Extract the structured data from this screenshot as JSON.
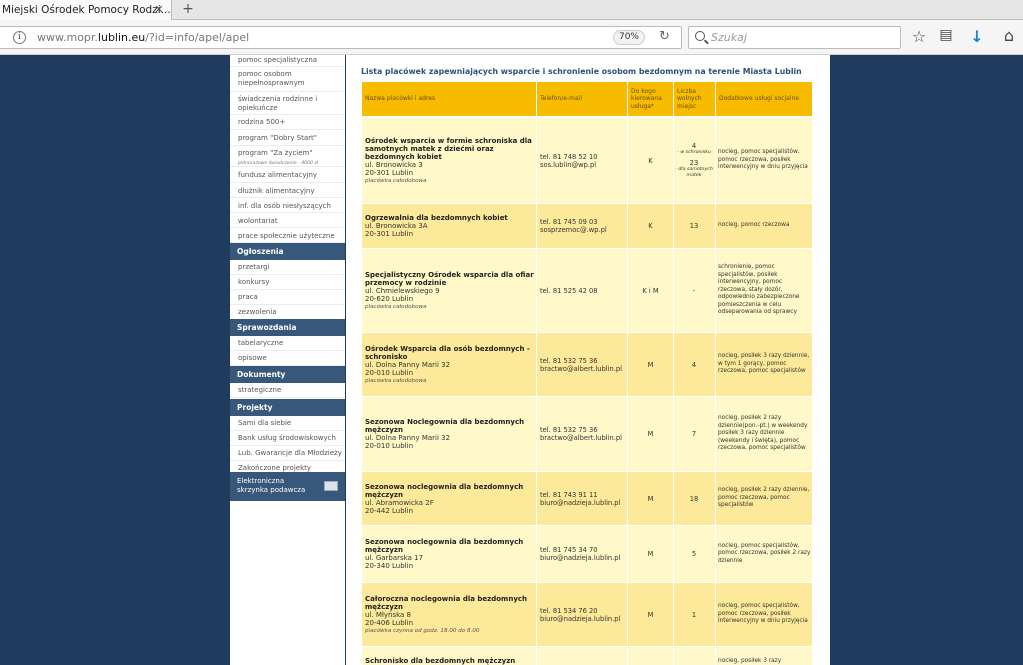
{
  "browser": {
    "tab_title": "Miejski Ośrodek Pomocy Rodzi...",
    "url_prefix": "www.mopr.",
    "url_domain": "lublin.eu",
    "url_suffix": "/?id=info/apel/apel",
    "zoom": "70%",
    "search_placeholder": "Szukaj"
  },
  "sidebar": {
    "items_top": [
      {
        "label": "pomoc specjalistyczna"
      },
      {
        "label": "pomoc osobom",
        "label2": "niepełnosprawnym"
      },
      {
        "label": "świadczenia rodzinne i",
        "label2": "opiekuńcze"
      },
      {
        "label": "rodzina 500+"
      },
      {
        "label": "program \"Dobry Start\""
      },
      {
        "label": "program \"Za życiem\"",
        "sub": "jednorazowe świadczenie - 4000 zł"
      },
      {
        "label": "fundusz alimentacyjny"
      },
      {
        "label": "dłużnik alimentacyjny"
      },
      {
        "label": "inf. dla osób niesłyszących"
      },
      {
        "label": "wolontariat"
      },
      {
        "label": "prace społecznie użyteczne"
      }
    ],
    "sections": [
      {
        "title": "Ogłoszenia",
        "items": [
          "przetargi",
          "konkursy",
          "praca",
          "zezwolenia"
        ]
      },
      {
        "title": "Sprawozdania",
        "items": [
          "tabelaryczne",
          "opisowe"
        ]
      },
      {
        "title": "Dokumenty",
        "items": [
          "strategiczne"
        ]
      },
      {
        "title": "Projekty",
        "items": [
          "Sami dla siebie",
          "Bank usług środowiskowych",
          "Lub. Gwarancje dla Młodzieży",
          "Zakończone projekty"
        ]
      }
    ],
    "electronic_line1": "Elektroniczna",
    "electronic_line2": "skrzynka podawcza"
  },
  "content": {
    "title": "Lista placówek zapewniających wsparcie i schronienie osobom bezdomnym na terenie Miasta Lublin",
    "headers": {
      "name": "Nazwa placówki i adres",
      "tel": "Telefon/e-mail",
      "who_1": "Do kogo",
      "who_2": "kierowana",
      "who_3": "usługa*",
      "free_1": "Liczba",
      "free_2": "wolnych",
      "free_3": "miejsc",
      "extra": "Dodatkowe usługi socjalne"
    },
    "rows": [
      {
        "name": "Ośrodek wsparcia w formie schroniska dla samotnych matek z dziećmi oraz bezdomnych kobiet",
        "street": "ul. Bronowicka 3",
        "city": "20-301 Lublin",
        "note": "placówka całodobowa",
        "tel": "tel. 81 748 52 10",
        "email": "sos.lublin@wp.pl",
        "who": "K",
        "free_a": "4",
        "free_a_sub": "- w schronisku",
        "free_b": "23",
        "free_b_sub": "- dla samotnych matek",
        "extra": "nocleg, pomoc specjalistów, pomoc rzeczowa, posiłek interwencyjny w dniu przyjęcia"
      },
      {
        "name": "Ogrzewalnia dla bezdomnych kobiet",
        "street": "ul. Bronowicka 3A",
        "city": "20-301 Lublin",
        "tel": "tel. 81 745 09 03",
        "email": "sosprzemoc@.wp.pl",
        "who": "K",
        "free": "13",
        "extra": "nocleg, pomoc rzeczowa"
      },
      {
        "name": "Specjalistyczny Ośrodek wsparcia dla ofiar przemocy w rodzinie",
        "street": "ul. Chmielewskiego 9",
        "city": "20-620 Lublin",
        "note": "placówka całodobowa",
        "tel": "tel. 81 525 42 08",
        "who": "K i M",
        "free": "-",
        "extra": "schronienie, pomoc specjalistów, posiłek interwencyjny, pomoc rzeczowa, stały dozór, odpowiednio zabezpieczone pomieszczenia w celu odseparowania od sprawcy"
      },
      {
        "name": "Ośrodek Wsparcia dla osób bezdomnych - schronisko",
        "street": "ul. Dolna Panny Marii 32",
        "city": "20-010 Lublin",
        "note": "placówka całodobowa",
        "tel": "tel. 81 532 75 36",
        "email": "bractwo@albert.lublin.pl",
        "who": "M",
        "free": "4",
        "extra": "nocleg, posiłek 3 razy dziennie, w tym 1 gorący, pomoc rzeczowa, pomoc specjalistów"
      },
      {
        "name": "Sezonowa Noclegownia dla bezdomnych mężczyzn",
        "street": "ul. Dolna Panny Marii 32",
        "city": "20-010 Lublin",
        "tel": "tel. 81 532 75 36",
        "email": "bractwo@albert.lublin.pl",
        "who": "M",
        "free": "7",
        "extra": "nocleg, posiłek 2 razy dziennie(pon.-pt.) w weekendy posiłek 3 razy dziennie (weekendy i święta), pomoc rzeczowa, pomoc specjalistów"
      },
      {
        "name": "Sezonowa noclegownia dla bezdomnych mężczyzn",
        "street": "ul. Abramowicka 2F",
        "city": "20-442 Lublin",
        "tel": "tel. 81 743 91 11",
        "email": "biuro@nadzieja.lublin.pl",
        "who": "M",
        "free": "18",
        "extra": "nocleg, posiłek 2 razy dziennie, pomoc rzeczowa, pomoc specjalistów"
      },
      {
        "name": "Sezonowa noclegownia dla bezdomnych mężczyzn",
        "street": "ul. Garbarska 17",
        "city": "20-340 Lublin",
        "tel": "tel. 81 745 34 70",
        "email": "biuro@nadzieja.lublin.pl",
        "who": "M",
        "free": "5",
        "extra": "nocleg, pomoc specjalistów, pomoc rzeczowa, posiłek 2 razy dziennie"
      },
      {
        "name": "Całoroczna noclegownia dla bezdomnych mężczyzn",
        "street": "ul. Młyńska 8",
        "city": "20-406 Lublin",
        "note": "placówka czynna od godz. 18.00 do 8.00",
        "tel": "tel. 81 534 76 20",
        "email": "biuro@nadzieja.lublin.pl",
        "who": "M",
        "free": "1",
        "extra": "nocleg, pomoc specjalistów, pomoc rzeczowa, posiłek interwencyjny w dniu przyjęcia"
      },
      {
        "name": "Schronisko dla bezdomnych mężczyzn",
        "extra": "nocleg, posiłek 3 razy"
      }
    ]
  }
}
